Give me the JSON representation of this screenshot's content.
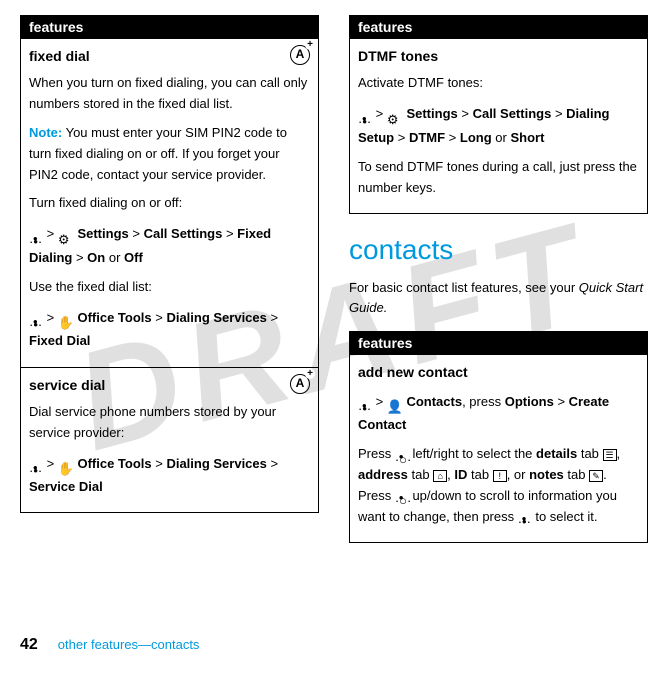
{
  "watermark": "DRAFT",
  "left": {
    "header": "features",
    "fixedDial": {
      "title": "fixed dial",
      "desc": "When you turn on fixed dialing, you can call only numbers stored in the fixed dial list.",
      "noteLabel": "Note:",
      "noteText": " You must enter your SIM PIN2 code to turn fixed dialing on or off. If you forget your PIN2 code, contact your service provider.",
      "turnText": "Turn fixed dialing on or off:",
      "path1": {
        "settings": "Settings",
        "callSettings": "Call Settings",
        "fixedDialing": "Fixed Dialing",
        "on": "On",
        "or": "or",
        "off": "Off"
      },
      "useText": "Use the fixed dial list:",
      "path2": {
        "officeTools": "Office Tools",
        "dialingServices": "Dialing Services",
        "fixedDial": "Fixed Dial"
      }
    },
    "serviceDial": {
      "title": "service dial",
      "desc": "Dial service phone numbers stored by your service provider:",
      "path": {
        "officeTools": "Office Tools",
        "dialingServices": "Dialing Services",
        "serviceDial": "Service Dial"
      }
    }
  },
  "right": {
    "header1": "features",
    "dtmf": {
      "title": "DTMF tones",
      "activate": "Activate DTMF tones:",
      "path": {
        "settings": "Settings",
        "callSettings": "Call Settings",
        "dialingSetup": "Dialing Setup",
        "dtmf": "DTMF",
        "long": "Long",
        "or": "or",
        "short": "Short"
      },
      "send": "To send DTMF tones during a call, just press the number keys."
    },
    "contactsHeading": "contacts",
    "contactsPara1": "For basic contact list features, see your ",
    "contactsPara2": "Quick Start Guide.",
    "header2": "features",
    "addContact": {
      "title": "add new contact",
      "path": {
        "contacts": "Contacts",
        "press": ", press",
        "options": "Options",
        "create": "Create Contact"
      },
      "desc1": "Press ",
      "desc2": " left/right to select the ",
      "details": "details",
      "tab1": " tab ",
      "address": "address",
      "tab2": " tab ",
      "id": "ID",
      "tab3": " tab ",
      "or": ", or ",
      "notes": "notes",
      "tab4": " tab ",
      "desc3": ". Press ",
      "desc4": " up/down to scroll to information you want to change, then press ",
      "desc5": " to select it."
    }
  },
  "footer": {
    "pageNum": "42",
    "text": "other features—contacts"
  }
}
